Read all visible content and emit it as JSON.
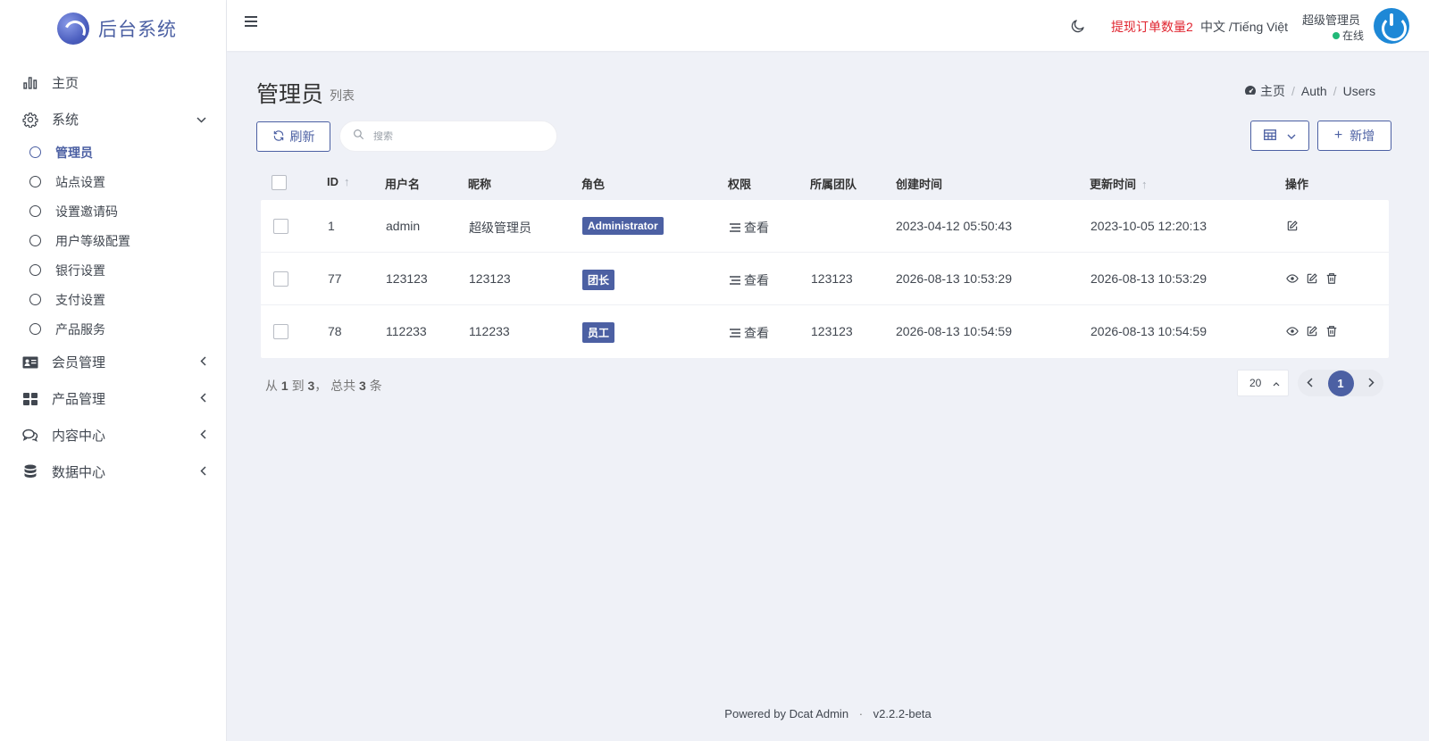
{
  "brand": {
    "title": "后台系统"
  },
  "sidebar": {
    "items": [
      {
        "label": "主页",
        "icon": "bar-chart-icon"
      },
      {
        "label": "系统",
        "icon": "gear-icon",
        "expanded": true,
        "children": [
          {
            "label": "管理员",
            "active": true
          },
          {
            "label": "站点设置"
          },
          {
            "label": "设置邀请码"
          },
          {
            "label": "用户等级配置"
          },
          {
            "label": "银行设置"
          },
          {
            "label": "支付设置"
          },
          {
            "label": "产品服务"
          }
        ]
      },
      {
        "label": "会员管理",
        "icon": "id-card-icon"
      },
      {
        "label": "产品管理",
        "icon": "grid-icon"
      },
      {
        "label": "内容中心",
        "icon": "chat-icon"
      },
      {
        "label": "数据中心",
        "icon": "database-icon"
      }
    ]
  },
  "header": {
    "alert": "提现订单数量2",
    "lang": "中文 /Tiếng Việt",
    "user_name": "超级管理员",
    "user_status": "在线"
  },
  "page": {
    "title": "管理员",
    "subtitle": "列表"
  },
  "breadcrumb": {
    "home": "主页",
    "auth": "Auth",
    "users": "Users"
  },
  "toolbar": {
    "refresh": "刷新",
    "search_placeholder": "搜索",
    "new": "新增"
  },
  "table": {
    "columns": {
      "id": "ID",
      "username": "用户名",
      "nickname": "昵称",
      "role": "角色",
      "perm": "权限",
      "team": "所属团队",
      "created": "创建时间",
      "updated": "更新时间",
      "actions": "操作"
    },
    "view_label": "查看",
    "rows": [
      {
        "id": "1",
        "username": "admin",
        "nickname": "超级管理员",
        "role": "Administrator",
        "team": "",
        "created": "2023-04-12 05:50:43",
        "updated": "2023-10-05 12:20:13"
      },
      {
        "id": "77",
        "username": "123123",
        "nickname": "123123",
        "role": "团长",
        "team": "123123",
        "created": "2026-08-13 10:53:29",
        "updated": "2026-08-13 10:53:29"
      },
      {
        "id": "78",
        "username": "112233",
        "nickname": "112233",
        "role": "员工",
        "team": "123123",
        "created": "2026-08-13 10:54:59",
        "updated": "2026-08-13 10:54:59"
      }
    ]
  },
  "pagination": {
    "summary_pre": "从",
    "from": "1",
    "summary_to": "到",
    "to": "3",
    "summary_total": "， 总共",
    "total": "3",
    "summary_unit": "条",
    "per_page": "20",
    "current": "1"
  },
  "footer": {
    "powered": "Powered by",
    "link": "Dcat Admin",
    "version": "v2.2.2-beta"
  },
  "colors": {
    "primary": "#4c60a3",
    "alert": "#e0242f",
    "online": "#21b978"
  }
}
